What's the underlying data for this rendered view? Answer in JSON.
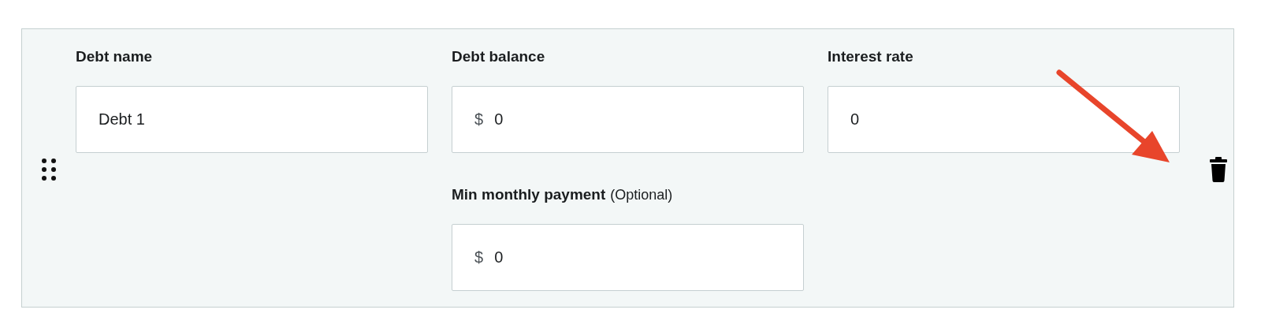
{
  "debt_entry": {
    "fields": [
      {
        "label": "Debt name",
        "value": "Debt 1"
      },
      {
        "label": "Debt balance",
        "prefix": "$",
        "value": "0"
      },
      {
        "label": "Interest rate",
        "value": "0"
      },
      {
        "label": "Min monthly payment",
        "note": "(Optional)",
        "prefix": "$",
        "value": "0"
      }
    ]
  }
}
